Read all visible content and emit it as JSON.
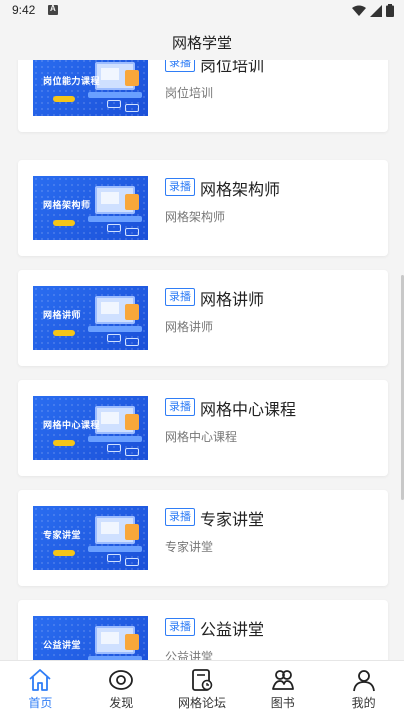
{
  "status_bar": {
    "time": "9:42"
  },
  "header": {
    "title": "网格学堂"
  },
  "courses": [
    {
      "thumb_text": "岗位能力课程",
      "badge": "录播",
      "title": "岗位培训",
      "subtitle": "岗位培训"
    },
    {
      "thumb_text": "网格架构师",
      "badge": "录播",
      "title": "网格架构师",
      "subtitle": "网格架构师"
    },
    {
      "thumb_text": "网格讲师",
      "badge": "录播",
      "title": "网格讲师",
      "subtitle": "网格讲师"
    },
    {
      "thumb_text": "网格中心课程",
      "badge": "录播",
      "title": "网格中心课程",
      "subtitle": "网格中心课程"
    },
    {
      "thumb_text": "专家讲堂",
      "badge": "录播",
      "title": "专家讲堂",
      "subtitle": "专家讲堂"
    },
    {
      "thumb_text": "公益讲堂",
      "badge": "录播",
      "title": "公益讲堂",
      "subtitle": "公益讲堂"
    }
  ],
  "tabbar": {
    "items": [
      {
        "label": "首页",
        "icon": "home-icon",
        "active": true
      },
      {
        "label": "发现",
        "icon": "eye-icon",
        "active": false
      },
      {
        "label": "网格论坛",
        "icon": "forum-icon",
        "active": false
      },
      {
        "label": "图书",
        "icon": "books-icon",
        "active": false
      },
      {
        "label": "我的",
        "icon": "user-icon",
        "active": false
      }
    ]
  },
  "colors": {
    "accent": "#2f7df6",
    "thumb_blue": "#1b50d8",
    "background": "#f4f4f4"
  }
}
